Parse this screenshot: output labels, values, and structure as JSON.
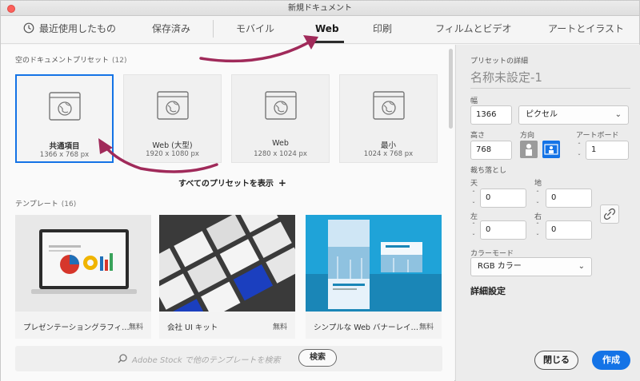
{
  "window": {
    "title": "新規ドキュメント"
  },
  "tabs": [
    {
      "label": "最近使用したもの",
      "icon": "clock-icon"
    },
    {
      "label": "保存済み"
    },
    {
      "label": "モバイル"
    },
    {
      "label": "Web",
      "active": true
    },
    {
      "label": "印刷"
    },
    {
      "label": "フィルムとビデオ"
    },
    {
      "label": "アートとイラスト"
    }
  ],
  "presets_section": {
    "title": "空のドキュメントプリセット",
    "count": "(12)"
  },
  "presets": [
    {
      "name": "共通項目",
      "size": "1366 x 768 px",
      "selected": true
    },
    {
      "name": "Web (大型)",
      "size": "1920 x 1080 px"
    },
    {
      "name": "Web",
      "size": "1280 x 1024 px"
    },
    {
      "name": "最小",
      "size": "1024 x 768 px"
    }
  ],
  "show_all": {
    "label": "すべてのプリセットを表示",
    "plus": "+"
  },
  "templates_section": {
    "title": "テンプレート",
    "count": "(16)"
  },
  "templates": [
    {
      "name": "プレゼンテーショングラフィ…",
      "price": "無料"
    },
    {
      "name": "会社 UI キット",
      "price": "無料"
    },
    {
      "name": "シンプルな Web バナーレイ…",
      "price": "無料"
    }
  ],
  "search": {
    "placeholder": "Adobe Stock で他のテンプレートを検索",
    "button": "検索"
  },
  "panel": {
    "header": "プリセットの詳細",
    "doc_name": "名称未設定-1",
    "width_label": "幅",
    "width_value": "1366",
    "unit": "ピクセル",
    "height_label": "高さ",
    "height_value": "768",
    "orientation_label": "方向",
    "artboard_label": "アートボード",
    "artboard_value": "1",
    "bleed_label": "裁ち落とし",
    "top_label": "天",
    "top_value": "0",
    "bottom_label": "地",
    "bottom_value": "0",
    "left_label": "左",
    "left_value": "0",
    "right_label": "右",
    "right_value": "0",
    "color_mode_label": "カラーモード",
    "color_mode_value": "RGB カラー",
    "advanced": "詳細設定",
    "close_button": "閉じる",
    "create_button": "作成"
  },
  "colors": {
    "accent": "#1473e6",
    "annotation_arrow": "#a02a5a"
  }
}
